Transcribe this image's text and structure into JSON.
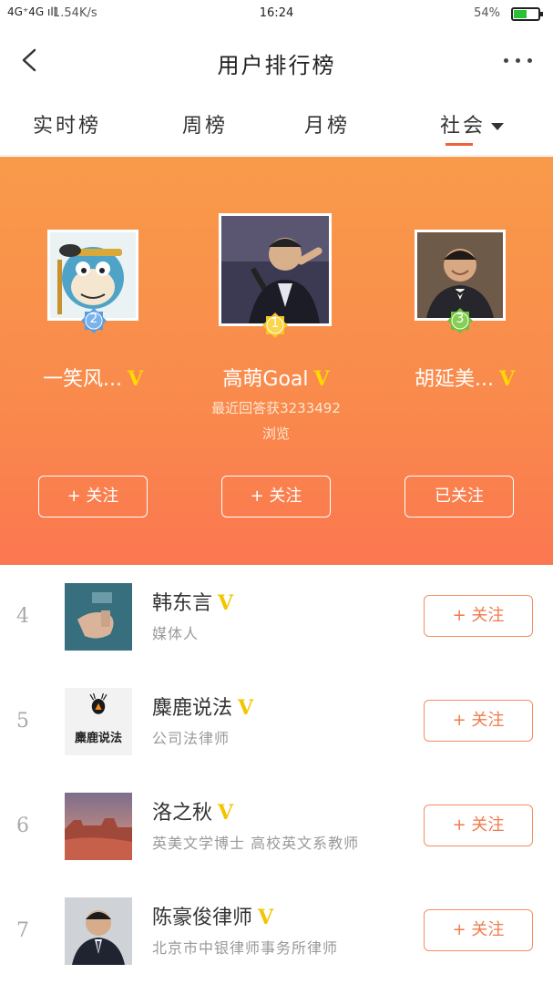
{
  "status_bar": {
    "signal": "4G⁺4G ıll",
    "speed": "1.54K/s",
    "time": "16:24",
    "battery": "54%",
    "battery_level": 0.54
  },
  "header": {
    "title": "用户排行榜"
  },
  "tabs": [
    {
      "label": "实时榜"
    },
    {
      "label": "周榜"
    },
    {
      "label": "月榜"
    },
    {
      "label": "社会",
      "active": true
    }
  ],
  "podium": {
    "second": {
      "rank": "2",
      "name": "一笑风...",
      "verified": "V",
      "button": "+ 关注"
    },
    "first": {
      "rank": "1",
      "name": "高萌Goal",
      "verified": "V",
      "sub_line1": "最近回答获3233492",
      "sub_line2": "浏览",
      "button": "+ 关注"
    },
    "third": {
      "rank": "3",
      "name": "胡延美...",
      "verified": "V",
      "button": "已关注"
    }
  },
  "list": [
    {
      "rank": "4",
      "name": "韩东言",
      "verified": "V",
      "desc": "媒体人",
      "button": "+ 关注"
    },
    {
      "rank": "5",
      "name": "麋鹿说法",
      "verified": "V",
      "desc": "公司法律师",
      "button": "+ 关注",
      "logo_text": "麋鹿说法"
    },
    {
      "rank": "6",
      "name": "洛之秋",
      "verified": "V",
      "desc": "英美文学博士 高校英文系教师",
      "button": "+ 关注"
    },
    {
      "rank": "7",
      "name": "陈豪俊律师",
      "verified": "V",
      "desc": "北京市中银律师事务所律师",
      "button": "+ 关注"
    }
  ],
  "colors": {
    "accent": "#f0623a",
    "hero_top": "#f99a4a",
    "hero_bottom": "#fb7750",
    "verified": "#ffd900",
    "medal_gold": "#f8c623",
    "medal_silver": "#5b9be0",
    "medal_bronze": "#6fbf3c"
  }
}
